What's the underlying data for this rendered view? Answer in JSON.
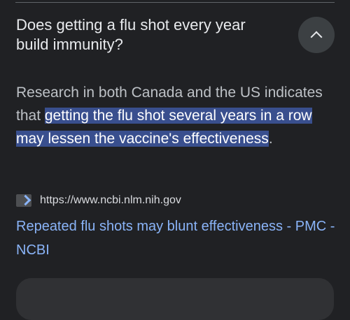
{
  "faq": {
    "question": "Does getting a flu shot every year build immunity?",
    "toggle_icon": "chevron-up-icon",
    "answer_prefix": "Research in both Canada and the US indicates that ",
    "answer_highlight": "getting the flu shot several years in a row may lessen the vaccine's effectiveness",
    "answer_suffix": "."
  },
  "source": {
    "favicon_icon": "ncbi-favicon-icon",
    "url": "https://www.ncbi.nlm.nih.gov",
    "title": "Repeated flu shots may blunt effectiveness - PMC - NCBI"
  },
  "colors": {
    "background": "#202124",
    "highlight": "#394f8e",
    "link": "#8ab4f8"
  }
}
